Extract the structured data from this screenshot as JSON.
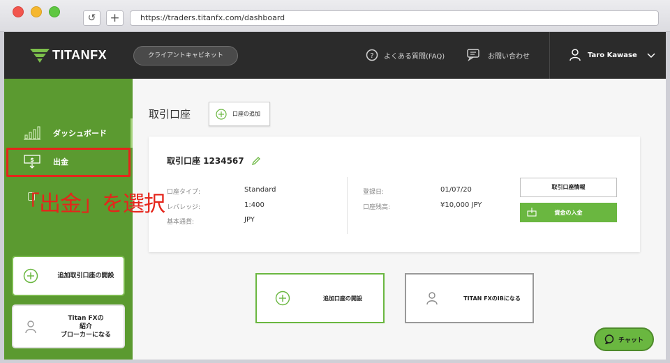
{
  "browser": {
    "url": "https://traders.titanfx.com/dashboard",
    "reload_icon": "reload-icon",
    "new_tab_icon": "plus-icon"
  },
  "header": {
    "logo_text": "TITANFX",
    "cabinet_label": "クライアントキャビネット",
    "faq_label": "よくある質問(FAQ)",
    "contact_label": "お問い合わせ",
    "user_name": "Taro Kawase"
  },
  "sidebar": {
    "items": [
      {
        "label": "ダッシュボード",
        "icon": "bar-chart-icon"
      },
      {
        "label": "出金",
        "icon": "withdraw-icon"
      }
    ],
    "cards": [
      {
        "label": "追加取引口座の開設",
        "icon": "plus-circle-icon"
      },
      {
        "label": "Titan FXの紹介ブローカーになる",
        "label_lines": [
          "Titan FXの",
          "紹介",
          "ブローカーになる"
        ],
        "icon": "person-icon"
      }
    ]
  },
  "main": {
    "section_title": "取引口座",
    "add_account_label": "口座の追加",
    "account": {
      "title": "取引口座 1234567",
      "fields_left": [
        {
          "label": "口座タイプ:",
          "value": "Standard"
        },
        {
          "label": "レバレッジ:",
          "value": "1:400"
        },
        {
          "label": "基本通貨:",
          "value": "JPY"
        }
      ],
      "fields_right": [
        {
          "label": "登録日:",
          "value": "01/07/20"
        },
        {
          "label": "口座残高:",
          "value": "¥10,000 JPY"
        }
      ],
      "info_button": "取引口座情報",
      "deposit_button": "資金の入金"
    },
    "open_account_label": "追加口座の開設",
    "ib_label": "TITAN FXのIBになる",
    "chat_label": "チャット"
  },
  "annotation": {
    "callout": "「出金」を選択",
    "color": "#e5251b"
  },
  "colors": {
    "accent_green": "#6ab740",
    "sidebar_green": "#5b9a30",
    "header_dark": "#2b2b2b"
  }
}
